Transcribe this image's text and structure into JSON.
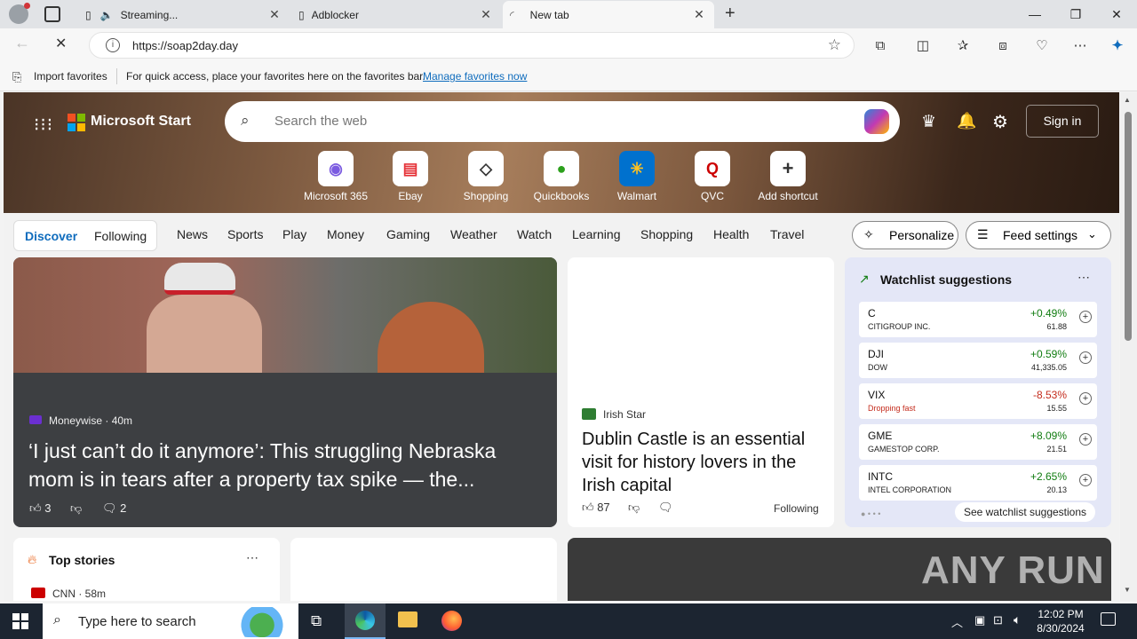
{
  "tabs": [
    {
      "title": "Streaming..."
    },
    {
      "title": "Adblocker"
    },
    {
      "title": "New tab"
    }
  ],
  "address": {
    "url": "https://soap2day.day"
  },
  "favbar": {
    "import_label": "Import favorites",
    "hint": "For quick access, place your favorites here on the favorites bar.",
    "manage_link": "Manage favorites now"
  },
  "header": {
    "brand": "Microsoft Start",
    "search_placeholder": "Search the web",
    "sign_in": "Sign in"
  },
  "shortcuts": [
    {
      "label": "Microsoft 365"
    },
    {
      "label": "Ebay"
    },
    {
      "label": "Shopping"
    },
    {
      "label": "Quickbooks"
    },
    {
      "label": "Walmart"
    },
    {
      "label": "QVC"
    },
    {
      "label": "Add shortcut"
    }
  ],
  "nav": {
    "discover": "Discover",
    "following": "Following",
    "items": [
      "News",
      "Sports",
      "Play",
      "Money",
      "Gaming",
      "Weather",
      "Watch",
      "Learning",
      "Shopping",
      "Health",
      "Travel"
    ],
    "personalize": "Personalize",
    "feed_settings": "Feed settings"
  },
  "main_story": {
    "source": "Moneywise · 40m",
    "title": "‘I just can’t do it anymore’: This struggling Nebraska mom is in tears after a property tax spike — the...",
    "likes": "3",
    "comments": "2"
  },
  "side_story": {
    "source": "Irish Star",
    "title": "Dublin Castle is an essential visit for history lovers in the Irish capital",
    "likes": "87",
    "following": "Following"
  },
  "watchlist": {
    "title": "Watchlist suggestions",
    "stocks": [
      {
        "symbol": "C",
        "name": "CITIGROUP INC.",
        "change": "+0.49%",
        "price": "61.88",
        "up": true
      },
      {
        "symbol": "DJI",
        "name": "DOW",
        "change": "+0.59%",
        "price": "41,335.05",
        "up": true
      },
      {
        "symbol": "VIX",
        "name": "Dropping fast",
        "change": "-8.53%",
        "price": "15.55",
        "up": false
      },
      {
        "symbol": "GME",
        "name": "GAMESTOP CORP.",
        "change": "+8.09%",
        "price": "21.51",
        "up": true
      },
      {
        "symbol": "INTC",
        "name": "INTEL CORPORATION",
        "change": "+2.65%",
        "price": "20.13",
        "up": true
      }
    ],
    "see_all": "See watchlist suggestions"
  },
  "top_stories": {
    "title": "Top stories",
    "first_source": "CNN · 58m"
  },
  "watermark": "ANY RUN",
  "taskbar": {
    "search_placeholder": "Type here to search",
    "time": "12:02 PM",
    "date": "8/30/2024"
  },
  "colors": {
    "up": "#107c10",
    "down": "#c42b1c",
    "accent": "#0f6cbd"
  }
}
